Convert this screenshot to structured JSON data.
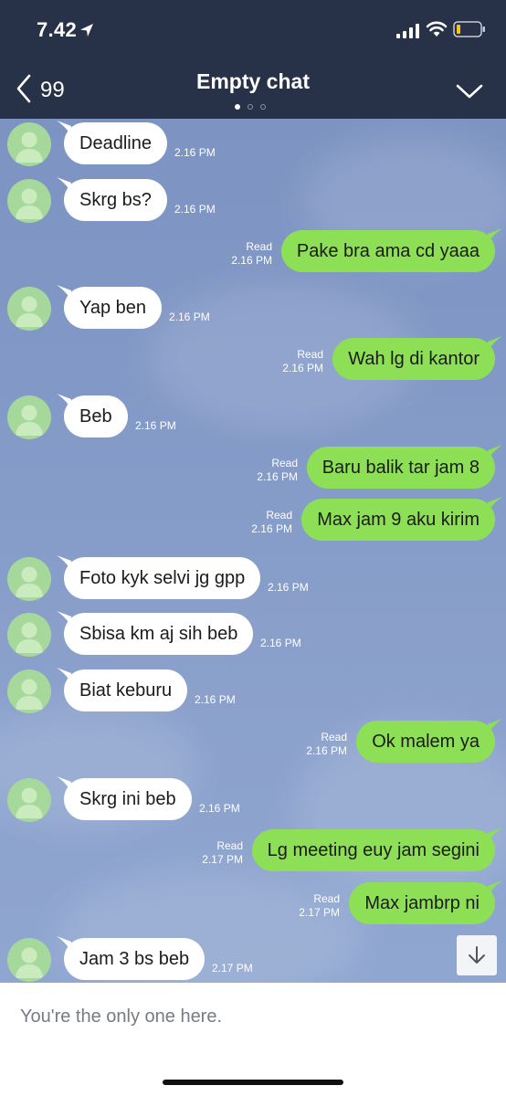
{
  "status_bar": {
    "time": "7.42",
    "icons": [
      "location-arrow-icon",
      "cellular-signal-icon",
      "wifi-icon",
      "battery-low-icon"
    ]
  },
  "nav": {
    "back_count": "99",
    "title": "Empty chat",
    "icons": [
      "chevron-left-icon",
      "chevron-down-icon"
    ]
  },
  "messages": [
    {
      "side": "in",
      "text": "Deadline",
      "time": "2.16 PM"
    },
    {
      "side": "in",
      "text": "Skrg bs?",
      "time": "2.16 PM"
    },
    {
      "side": "out",
      "text": "Pake bra ama cd yaaa",
      "read": "Read",
      "time": "2.16 PM"
    },
    {
      "side": "in",
      "text": "Yap ben",
      "time": "2.16 PM"
    },
    {
      "side": "out",
      "text": "Wah lg di kantor",
      "read": "Read",
      "time": "2.16 PM"
    },
    {
      "side": "in",
      "text": "Beb",
      "time": "2.16 PM"
    },
    {
      "side": "out",
      "text": "Baru balik tar jam 8",
      "read": "Read",
      "time": "2.16 PM"
    },
    {
      "side": "out",
      "text": "Max jam 9 aku kirim",
      "read": "Read",
      "time": "2.16 PM"
    },
    {
      "side": "in",
      "text": "Foto kyk selvi jg gpp",
      "time": "2.16 PM"
    },
    {
      "side": "in",
      "text": "Sbisa km aj sih beb",
      "time": "2.16 PM"
    },
    {
      "side": "in",
      "text": "Biat keburu",
      "time": "2.16 PM"
    },
    {
      "side": "out",
      "text": "Ok malem ya",
      "read": "Read",
      "time": "2.16 PM"
    },
    {
      "side": "in",
      "text": "Skrg ini beb",
      "time": "2.16 PM"
    },
    {
      "side": "out",
      "text": "Lg meeting euy jam segini",
      "read": "Read",
      "time": "2.17 PM"
    },
    {
      "side": "out",
      "text": "Max jambrp ni",
      "read": "Read",
      "time": "2.17 PM"
    },
    {
      "side": "in",
      "text": "Jam 3 bs beb",
      "time": "2.17 PM"
    }
  ],
  "footer": {
    "notice": "You're the only one here."
  },
  "colors": {
    "header_bg": "#273147",
    "incoming_bubble": "#ffffff",
    "outgoing_bubble": "#8de055",
    "avatar_bg": "#a6d89b",
    "chat_bg": "#8298c6"
  }
}
